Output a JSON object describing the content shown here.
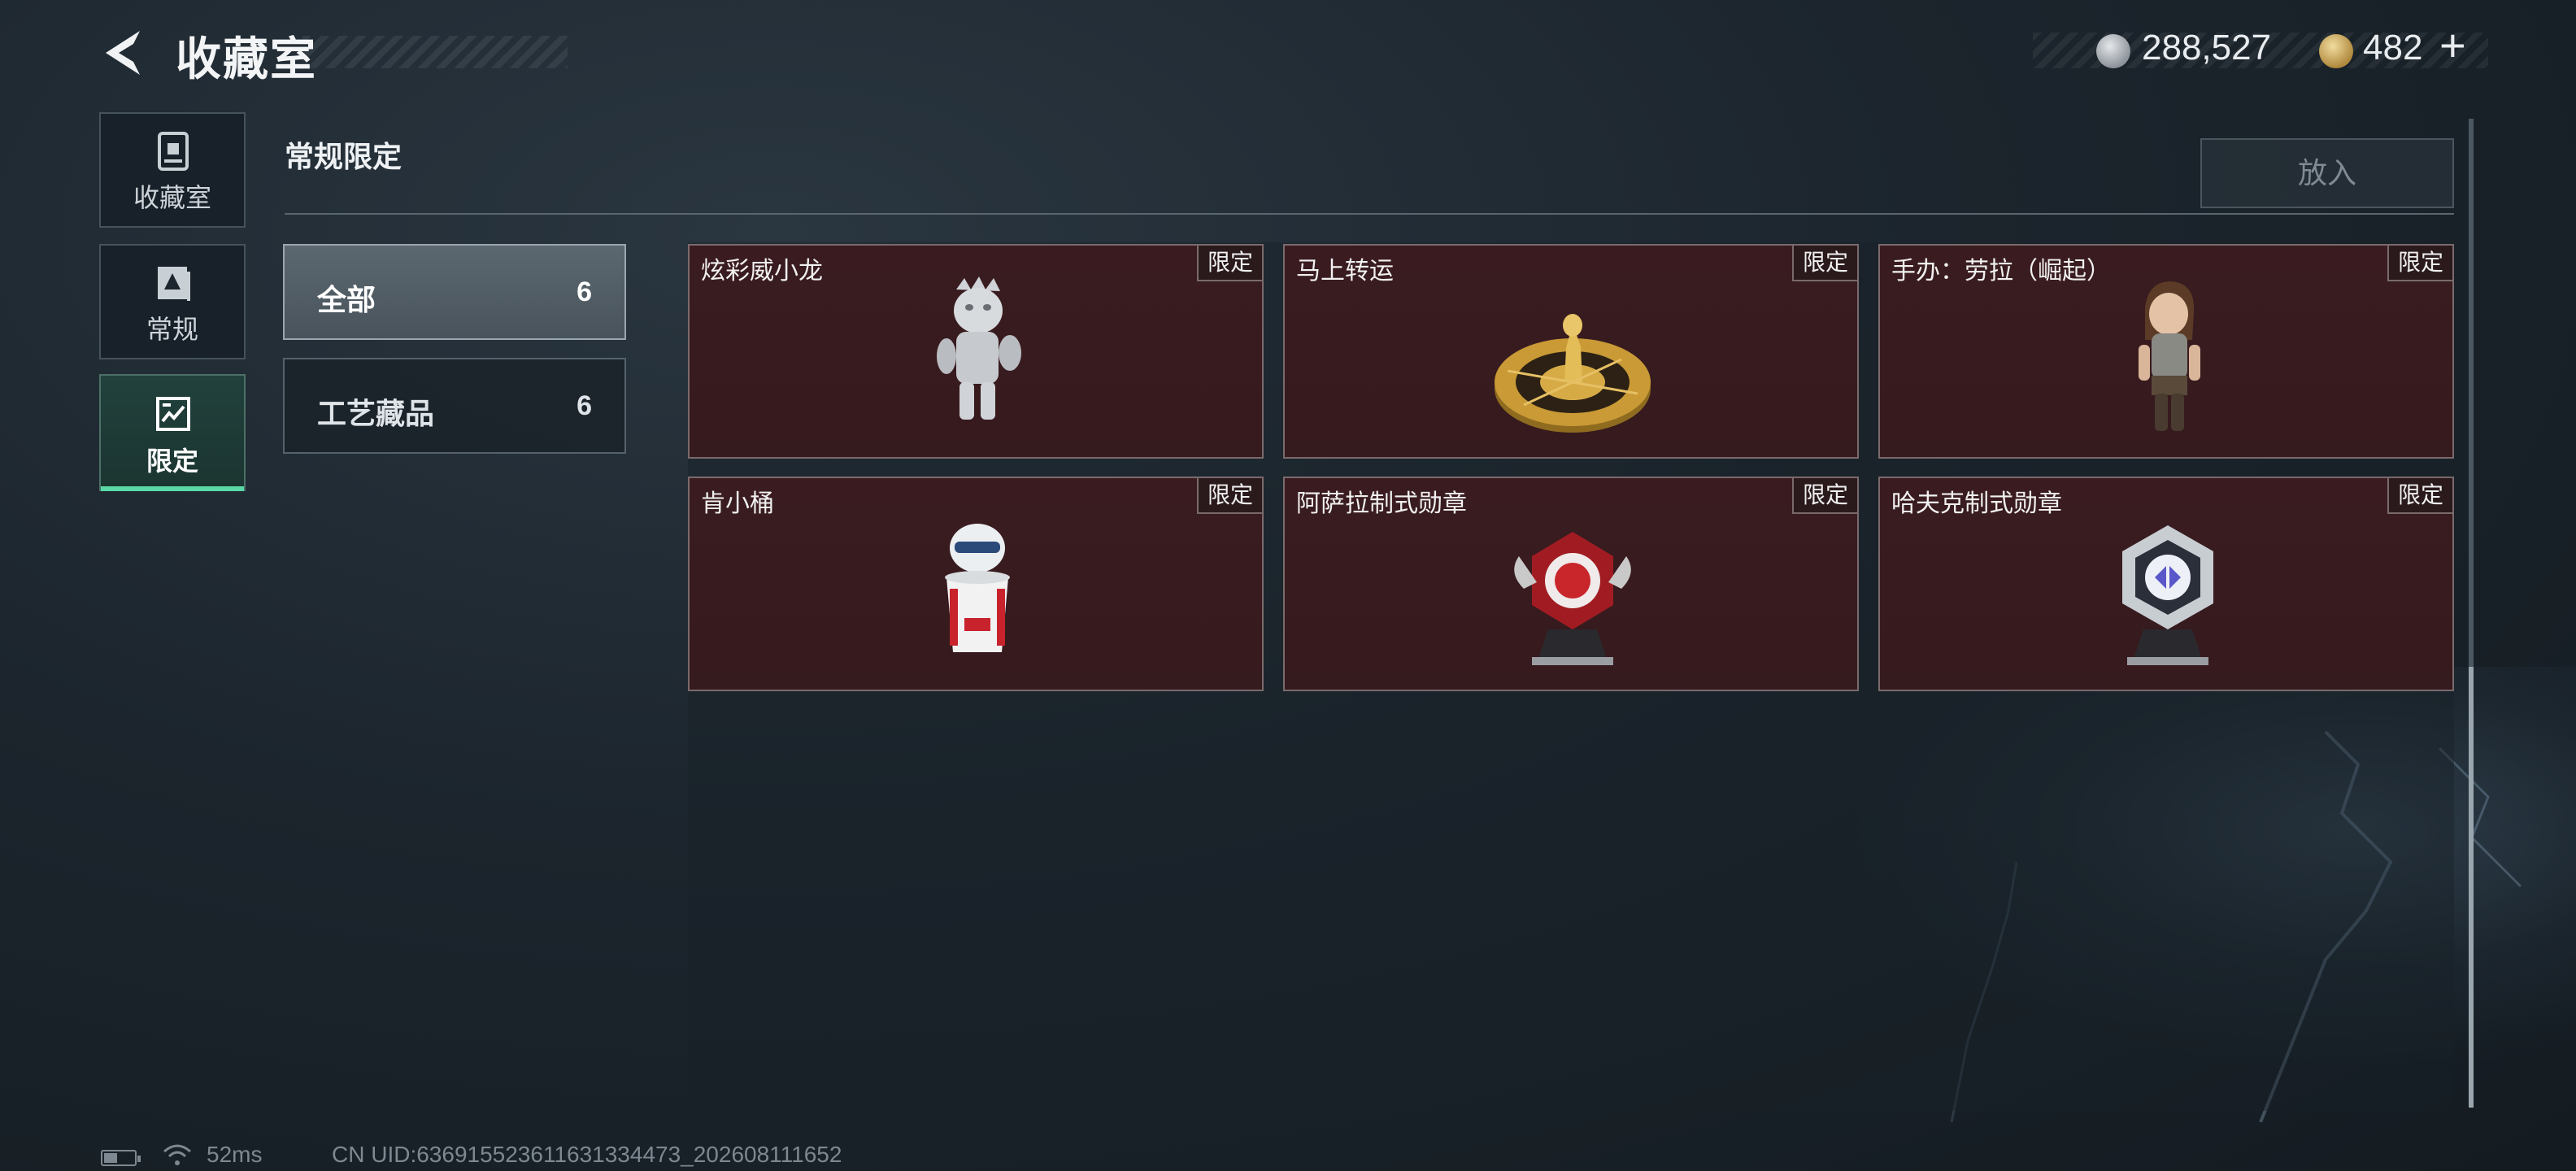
{
  "header": {
    "title": "收藏室",
    "currency_silver": "288,527",
    "currency_gold": "482",
    "plus": "+"
  },
  "nav": {
    "items": [
      {
        "label": "收藏室",
        "icon": "trophy-case-icon"
      },
      {
        "label": "常规",
        "icon": "card-icon"
      },
      {
        "label": "限定",
        "icon": "limited-card-icon",
        "active": true
      }
    ]
  },
  "section": {
    "title": "常规限定",
    "put_button": "放入"
  },
  "filters": [
    {
      "label": "全部",
      "count": "6",
      "active": true
    },
    {
      "label": "工艺藏品",
      "count": "6"
    }
  ],
  "items": [
    {
      "name": "炫彩威小龙",
      "tag": "限定",
      "art": "dragon-figure-icon"
    },
    {
      "name": "马上转运",
      "tag": "限定",
      "art": "golden-wheel-icon"
    },
    {
      "name": "手办：劳拉（崛起）",
      "tag": "限定",
      "art": "lara-figure-icon"
    },
    {
      "name": "肯小桶",
      "tag": "限定",
      "art": "kfc-bucket-figure-icon"
    },
    {
      "name": "阿萨拉制式勋章",
      "tag": "限定",
      "art": "red-medal-icon"
    },
    {
      "name": "哈夫克制式勋章",
      "tag": "限定",
      "art": "silver-medal-icon"
    }
  ],
  "status": {
    "ping": "52ms",
    "uid": "CN UID:636915523611631334473_202608111652"
  },
  "colors": {
    "accent": "#5ad9a6",
    "card_bg": "#3a1c20",
    "card_border": "#7a6a6c"
  }
}
